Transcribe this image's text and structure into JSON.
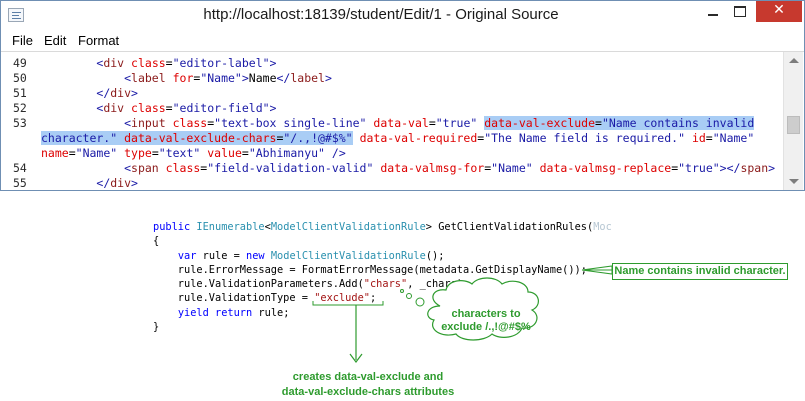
{
  "window": {
    "title": "http://localhost:18139/student/Edit/1 - Original Source",
    "close_glyph": "✕"
  },
  "menu": [
    "File",
    "Edit",
    "Format"
  ],
  "source_lines": [
    {
      "number": "49",
      "segments": [
        [
          "tx",
          "        "
        ],
        [
          "p",
          "<"
        ],
        [
          "t",
          "div"
        ],
        [
          "tx",
          " "
        ],
        [
          "a",
          "class"
        ],
        [
          "tx",
          "="
        ],
        [
          "v",
          "\"editor-label\""
        ],
        [
          "p",
          ">"
        ]
      ]
    },
    {
      "number": "50",
      "segments": [
        [
          "tx",
          "            "
        ],
        [
          "p",
          "<"
        ],
        [
          "t",
          "label"
        ],
        [
          "tx",
          " "
        ],
        [
          "a",
          "for"
        ],
        [
          "tx",
          "="
        ],
        [
          "v",
          "\"Name\""
        ],
        [
          "p",
          ">"
        ],
        [
          "tx",
          "Name"
        ],
        [
          "p",
          "</"
        ],
        [
          "t",
          "label"
        ],
        [
          "p",
          ">"
        ]
      ]
    },
    {
      "number": "51",
      "segments": [
        [
          "tx",
          "        "
        ],
        [
          "p",
          "</"
        ],
        [
          "t",
          "div"
        ],
        [
          "p",
          ">"
        ]
      ]
    },
    {
      "number": "52",
      "segments": [
        [
          "tx",
          "        "
        ],
        [
          "p",
          "<"
        ],
        [
          "t",
          "div"
        ],
        [
          "tx",
          " "
        ],
        [
          "a",
          "class"
        ],
        [
          "tx",
          "="
        ],
        [
          "v",
          "\"editor-field\""
        ],
        [
          "p",
          ">"
        ]
      ]
    },
    {
      "number": "53",
      "segments": [
        [
          "tx",
          "            "
        ],
        [
          "p",
          "<"
        ],
        [
          "t",
          "input"
        ],
        [
          "tx",
          " "
        ],
        [
          "a",
          "class"
        ],
        [
          "tx",
          "="
        ],
        [
          "v",
          "\"text-box single-line\""
        ],
        [
          "tx",
          " "
        ],
        [
          "a",
          "data-val"
        ],
        [
          "tx",
          "="
        ],
        [
          "v",
          "\"true\""
        ],
        [
          "tx",
          " "
        ],
        [
          "a sel",
          "data-val-exclude"
        ],
        [
          "tx sel",
          "="
        ],
        [
          "v sel",
          "\"Name contains invalid"
        ]
      ]
    },
    {
      "number": "",
      "segments": [
        [
          "v sel",
          "character.\""
        ],
        [
          "tx sel",
          " "
        ],
        [
          "a sel",
          "data-val-exclude-chars"
        ],
        [
          "tx sel",
          "="
        ],
        [
          "v sel",
          "\"/.,!@#$%\""
        ],
        [
          "tx",
          " "
        ],
        [
          "a",
          "data-val-required"
        ],
        [
          "tx",
          "="
        ],
        [
          "v",
          "\"The Name field is required.\""
        ],
        [
          "tx",
          " "
        ],
        [
          "a",
          "id"
        ],
        [
          "tx",
          "="
        ],
        [
          "v",
          "\"Name\""
        ]
      ]
    },
    {
      "number": "",
      "segments": [
        [
          "a",
          "name"
        ],
        [
          "tx",
          "="
        ],
        [
          "v",
          "\"Name\""
        ],
        [
          "tx",
          " "
        ],
        [
          "a",
          "type"
        ],
        [
          "tx",
          "="
        ],
        [
          "v",
          "\"text\""
        ],
        [
          "tx",
          " "
        ],
        [
          "a",
          "value"
        ],
        [
          "tx",
          "="
        ],
        [
          "v",
          "\"Abhimanyu\""
        ],
        [
          "tx",
          " "
        ],
        [
          "p",
          "/>"
        ]
      ]
    },
    {
      "number": "54",
      "segments": [
        [
          "tx",
          "            "
        ],
        [
          "p",
          "<"
        ],
        [
          "t",
          "span"
        ],
        [
          "tx",
          " "
        ],
        [
          "a",
          "class"
        ],
        [
          "tx",
          "="
        ],
        [
          "v",
          "\"field-validation-valid\""
        ],
        [
          "tx",
          " "
        ],
        [
          "a",
          "data-valmsg-for"
        ],
        [
          "tx",
          "="
        ],
        [
          "v",
          "\"Name\""
        ],
        [
          "tx",
          " "
        ],
        [
          "a",
          "data-valmsg-replace"
        ],
        [
          "tx",
          "="
        ],
        [
          "v",
          "\"true\""
        ],
        [
          "p",
          "></"
        ],
        [
          "t",
          "span"
        ],
        [
          "p",
          ">"
        ]
      ]
    },
    {
      "number": "55",
      "segments": [
        [
          "tx",
          "        "
        ],
        [
          "p",
          "</"
        ],
        [
          "t",
          "div"
        ],
        [
          "p",
          ">"
        ]
      ]
    }
  ],
  "csharp_lines": [
    [
      [
        "kw",
        "public "
      ],
      [
        "ty",
        "IEnumerable"
      ],
      [
        "",
        "<"
      ],
      [
        "ty",
        "ModelClientValidationRule"
      ],
      [
        "",
        "> GetClientValidationRules("
      ],
      [
        "fade",
        "Moc"
      ]
    ],
    [
      [
        "",
        "{"
      ]
    ],
    [
      [
        "",
        "    "
      ],
      [
        "kw",
        "var"
      ],
      [
        "",
        " rule = "
      ],
      [
        "kw",
        "new "
      ],
      [
        "ty",
        "ModelClientValidationRule"
      ],
      [
        "",
        "();"
      ]
    ],
    [
      [
        "",
        "    rule.ErrorMessage = FormatErrorMessage(metadata.GetDisplayName());"
      ]
    ],
    [
      [
        "",
        "    rule.ValidationParameters.Add("
      ],
      [
        "st",
        "\"chars\""
      ],
      [
        "",
        ", _chars);"
      ]
    ],
    [
      [
        "",
        "    rule.ValidationType = "
      ],
      [
        "st",
        "\"exclude\""
      ],
      [
        "",
        ";"
      ]
    ],
    [
      [
        "",
        "    "
      ],
      [
        "kw",
        "yield return"
      ],
      [
        "",
        " rule;"
      ]
    ],
    [
      [
        "",
        "}"
      ]
    ]
  ],
  "annotations": {
    "error_message": "Name contains invalid character.",
    "chars_line1": "characters to",
    "chars_line2": "exclude /.,!@#$%",
    "attributes_line1": "creates data-val-exclude and",
    "attributes_line2": "data-val-exclude-chars attributes"
  },
  "colors": {
    "annotation": "#2e9b2e",
    "selection": "#a9cdf5",
    "close_button": "#c7392e"
  }
}
